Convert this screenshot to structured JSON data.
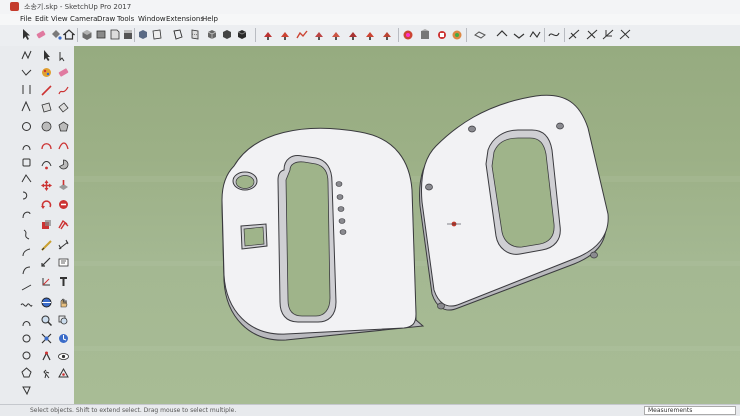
{
  "window": {
    "title": "소송기.skp - SketchUp Pro 2017"
  },
  "menu": {
    "items": [
      "File",
      "Edit",
      "View",
      "Camera",
      "Draw",
      "Tools",
      "Window",
      "Extensions",
      "Help"
    ]
  },
  "toolbar": {
    "icons": [
      "select-icon",
      "eraser-icon",
      "paint-bucket-icon",
      "home-icon",
      "iso-view-icon",
      "top-view-icon",
      "front-view-icon",
      "right-view-icon",
      "back-view-icon",
      "left-view-icon",
      "xray-icon",
      "back-edges-icon",
      "wireframe-icon",
      "hidden-line-icon",
      "shaded-icon",
      "shaded-textures-icon",
      "monochrome-icon",
      "sandbox-from-contours-icon",
      "sandbox-from-scratch-icon",
      "smoove-icon",
      "stamp-icon",
      "drape-icon",
      "add-detail-icon",
      "flip-edge-icon",
      "warehouse-icon",
      "extension-warehouse-icon",
      "layout-icon",
      "follow-me-icon",
      "solid-union-icon",
      "solid-subtract-icon",
      "solid-trim-icon",
      "solid-split-icon",
      "outer-shell-icon",
      "intersect-icon",
      "sweep-icon",
      "loft-icon"
    ]
  },
  "colors": {
    "viewport_top": "#96ab80",
    "viewport_bottom": "#a8bc95",
    "part_face": "#f2f2f4",
    "part_side": "#b9b9be",
    "edge": "#3a3a3e"
  },
  "status": {
    "hint": "Select objects. Shift to extend select. Drag mouse to select multiple.",
    "measurements_label": "Measurements"
  }
}
